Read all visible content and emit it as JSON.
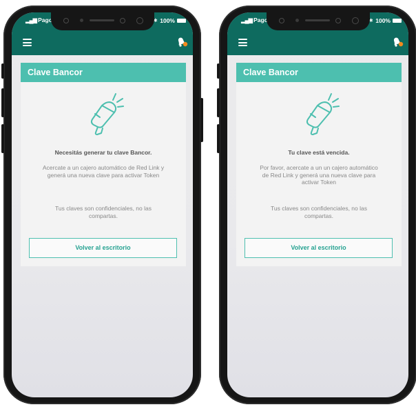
{
  "status_bar": {
    "carrier": "Pagos",
    "battery": "100%",
    "bluetooth": "∗"
  },
  "colors": {
    "appbar": "#0e6b5f",
    "card_header": "#4dbfaf",
    "accent": "#26a291",
    "notification_dot": "#f28a1e"
  },
  "icons": {
    "menu": "hamburger-menu-icon",
    "notifications": "bell-icon",
    "illustration": "megaphone-icon"
  },
  "screens": [
    {
      "card_title": "Clave Bancor",
      "message_title": "Necesitás generar tu clave Bancor.",
      "message_body": "Acercate a un cajero automático de Red Link y generá una nueva clave para activar Token",
      "note": "Tus claves son confidenciales, no las compartas.",
      "button_label": "Volver al escritorio"
    },
    {
      "card_title": "Clave Bancor",
      "message_title": "Tu clave está vencida.",
      "message_body": "Por favor, acercate a un un cajero automático de Red Link y generá una nueva clave para activar Token",
      "note": "Tus claves son confidenciales, no las compartas.",
      "button_label": "Volver al escritorio"
    }
  ]
}
